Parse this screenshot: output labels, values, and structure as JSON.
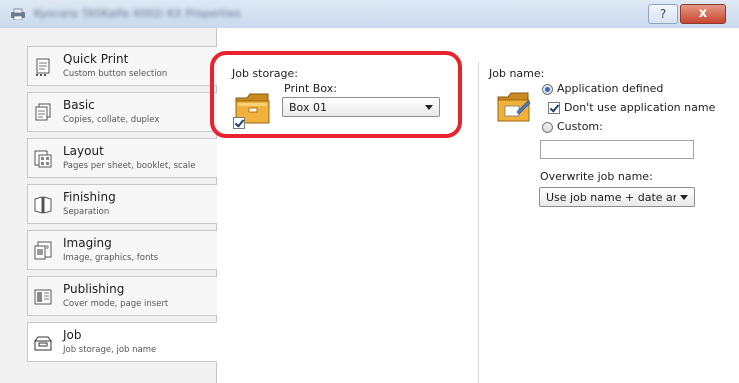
{
  "window": {
    "title": "Kyocera TASKalfa 4002i KX Properties",
    "help_label": "?",
    "close_label": "x"
  },
  "sidebar": {
    "items": [
      {
        "title": "Quick Print",
        "subtitle": "Custom button selection",
        "icon": "quick-print-icon"
      },
      {
        "title": "Basic",
        "subtitle": "Copies, collate, duplex",
        "icon": "basic-icon"
      },
      {
        "title": "Layout",
        "subtitle": "Pages per sheet, booklet, scale",
        "icon": "layout-icon"
      },
      {
        "title": "Finishing",
        "subtitle": "Separation",
        "icon": "finishing-icon"
      },
      {
        "title": "Imaging",
        "subtitle": "Image, graphics, fonts",
        "icon": "imaging-icon"
      },
      {
        "title": "Publishing",
        "subtitle": "Cover mode, page insert",
        "icon": "publishing-icon"
      },
      {
        "title": "Job",
        "subtitle": "Job storage, job name",
        "icon": "job-icon"
      }
    ],
    "active_index": 6
  },
  "job_storage": {
    "heading": "Job storage:",
    "print_box_label": "Print Box:",
    "print_box_value": "Box 01",
    "enabled": true
  },
  "job_name": {
    "heading": "Job name:",
    "application_defined_label": "Application defined",
    "application_defined_selected": true,
    "dont_use_app_name_label": "Don't use application name",
    "dont_use_app_name_checked": true,
    "custom_label": "Custom:",
    "custom_selected": false,
    "custom_value": "",
    "overwrite_label": "Overwrite job name:",
    "overwrite_value": "Use job name + date and t"
  },
  "colors": {
    "highlight": "#e8232f",
    "accent": "#2b6cc4",
    "folder": "#e8a531"
  }
}
